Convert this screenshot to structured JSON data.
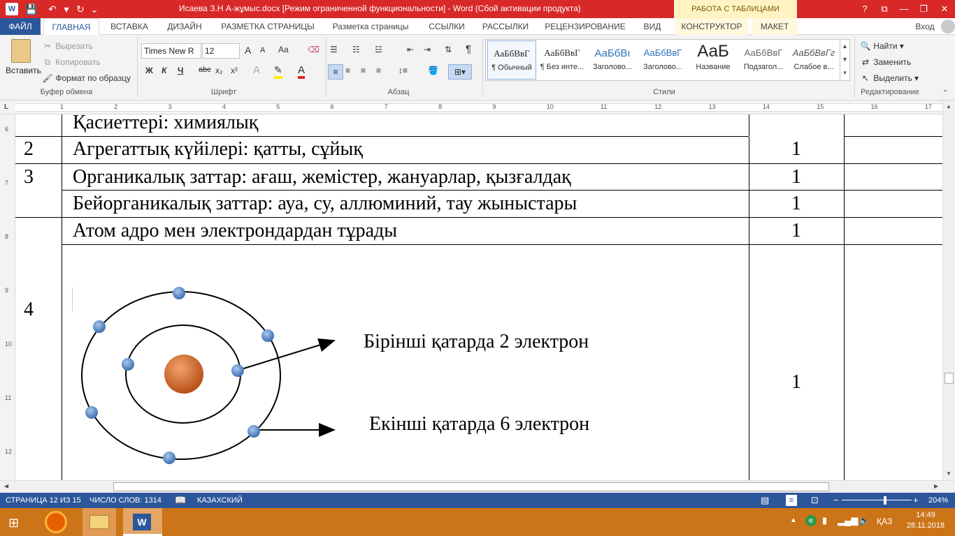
{
  "titlebar": {
    "title": "Исаева З.Н   А-жұмыс.docx [Режим ограниченной функциональности] -  Word (Сбой активации продукта)",
    "context_tab": "РАБОТА С ТАБЛИЦАМИ",
    "help": "?",
    "ribbon_display": "⧉",
    "minimize": "—",
    "restore": "❐",
    "close": "✕"
  },
  "menu": {
    "file": "ФАЙЛ",
    "tabs": [
      "ГЛАВНАЯ",
      "ВСТАВКА",
      "ДИЗАЙН",
      "РАЗМЕТКА СТРАНИЦЫ",
      "Разметка страницы",
      "ССЫЛКИ",
      "РАССЫЛКИ",
      "РЕЦЕНЗИРОВАНИЕ",
      "ВИД",
      "КОНСТРУКТОР",
      "МАКЕТ"
    ],
    "signin": "Вход"
  },
  "clipboard": {
    "paste": "Вставить",
    "cut": "Вырезать",
    "copy": "Копировать",
    "format_painter": "Формат по образцу",
    "label": "Буфер обмена"
  },
  "font": {
    "name": "Times New R",
    "size": "12",
    "label": "Шрифт",
    "bold": "Ж",
    "italic": "К",
    "underline": "Ч",
    "strike": "abc",
    "subscript": "x₂",
    "superscript": "x²",
    "grow": "A",
    "shrink": "A",
    "case": "Aa"
  },
  "paragraph": {
    "label": "Абзац",
    "marks": "¶"
  },
  "styles": {
    "label": "Стили",
    "items": [
      {
        "sample": "АаБбВвГ",
        "name": "¶ Обычный"
      },
      {
        "sample": "АаБбВвГ",
        "name": "¶ Без инте..."
      },
      {
        "sample": "АаБбВı",
        "name": "Заголово..."
      },
      {
        "sample": "АаБбВвГ",
        "name": "Заголово..."
      },
      {
        "sample": "АаБ",
        "name": "Название"
      },
      {
        "sample": "АаБбВвГ",
        "name": "Подзагол..."
      },
      {
        "sample": "АаБбВвГг",
        "name": "Слабое в..."
      }
    ]
  },
  "editing": {
    "find": "Найти",
    "replace": "Заменить",
    "select": "Выделить",
    "label": "Редактирование"
  },
  "ruler": {
    "h_numbers": [
      "1",
      "2",
      "3",
      "4",
      "5",
      "6",
      "7",
      "8",
      "9",
      "10",
      "11",
      "12",
      "13",
      "14",
      "15",
      "16",
      "17"
    ],
    "v_numbers": [
      "6",
      "7",
      "8",
      "9",
      "10",
      "11",
      "12"
    ]
  },
  "document": {
    "rows": [
      {
        "num": "",
        "text": "Қасиеттері: химиялық",
        "score": ""
      },
      {
        "num": "2",
        "text": "Агрегаттық күйілері: қатты, сұйық",
        "score": "1"
      },
      {
        "num": "3",
        "text": "Органикалық заттар: ағаш, жемістер, жануарлар, қызғалдақ",
        "score": "1"
      },
      {
        "num": "",
        "text": "Бейорганикалық заттар: ауа, су, аллюминий, тау жыныстары",
        "score": "1"
      },
      {
        "num": "",
        "text": "Атом адро мен электрондардан тұрады",
        "score": "1"
      },
      {
        "num": "4",
        "text": "",
        "score": "1"
      }
    ],
    "label_first": "Бірінші қатарда 2 электрон",
    "label_second": "Екінші қатарда 6 электрон",
    "colors": {
      "nucleus": "#e06b1f",
      "electron": "#4f86c6"
    }
  },
  "status": {
    "page": "СТРАНИЦА 12 ИЗ 15",
    "words": "ЧИСЛО СЛОВ: 1314",
    "language": "КАЗАХСКИЙ",
    "zoom": "204%",
    "zoom_minus": "−",
    "zoom_plus": "+"
  },
  "taskbar": {
    "lang": "ҚАЗ",
    "time": "14:49",
    "date": "28.11.2018",
    "word_label": "W"
  }
}
